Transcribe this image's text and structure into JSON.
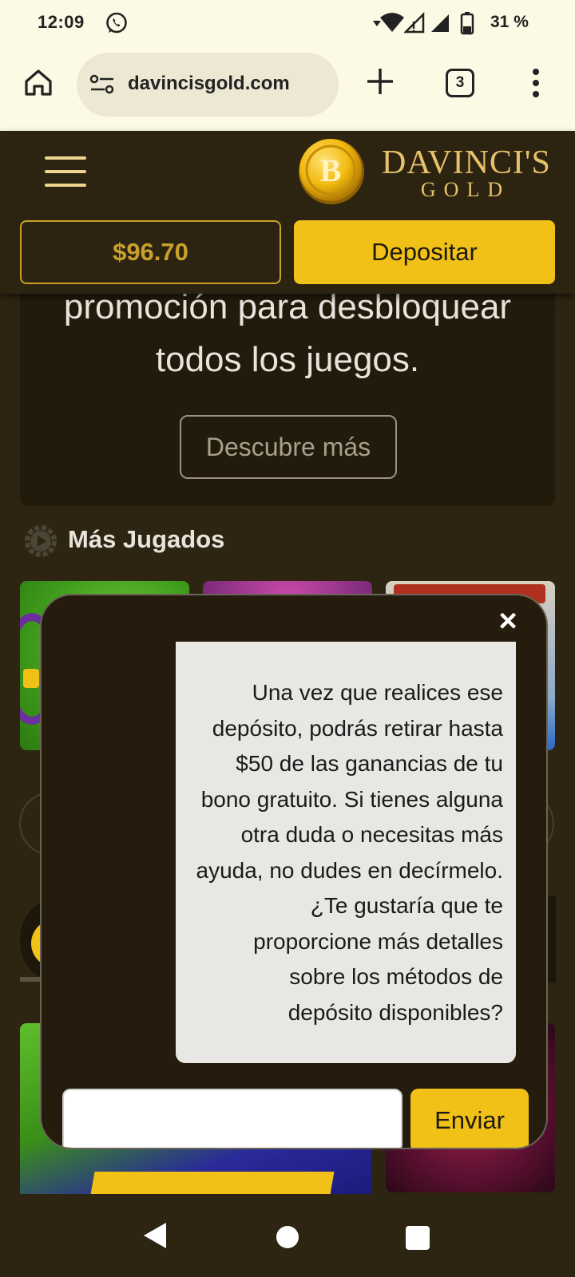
{
  "status_bar": {
    "time": "12:09",
    "battery": "31 %",
    "icons": [
      "whatsapp-icon",
      "wifi-icon",
      "signal-icon",
      "battery-icon"
    ]
  },
  "browser": {
    "url": "davincisgold.com",
    "tab_count": "3"
  },
  "site": {
    "logo_line1": "DAVINCI'S",
    "logo_line2": "GOLD",
    "balance": "$96.70",
    "deposit_label": "Depositar"
  },
  "promo": {
    "line1": "promoción para desbloquear",
    "line2": "todos los juegos.",
    "button": "Descubre más"
  },
  "section": {
    "title": "Más Jugados"
  },
  "chat": {
    "close": "×",
    "lines": [
      "Una vez que realices ese",
      "depósito, podrás retirar hasta",
      "$50 de las ganancias de tu",
      "bono gratuito. Si tienes alguna",
      "otra duda o necesitas más",
      "ayuda, no dudes en decírmelo.",
      "¿Te gustaría que te",
      "proporcione más detalles",
      "sobre los métodos de",
      "depósito disponibles?"
    ],
    "send_label": "Enviar",
    "input_value": ""
  },
  "colors": {
    "accent": "#f2c117",
    "background": "#2e2412",
    "gold_text": "#c9a12a"
  }
}
